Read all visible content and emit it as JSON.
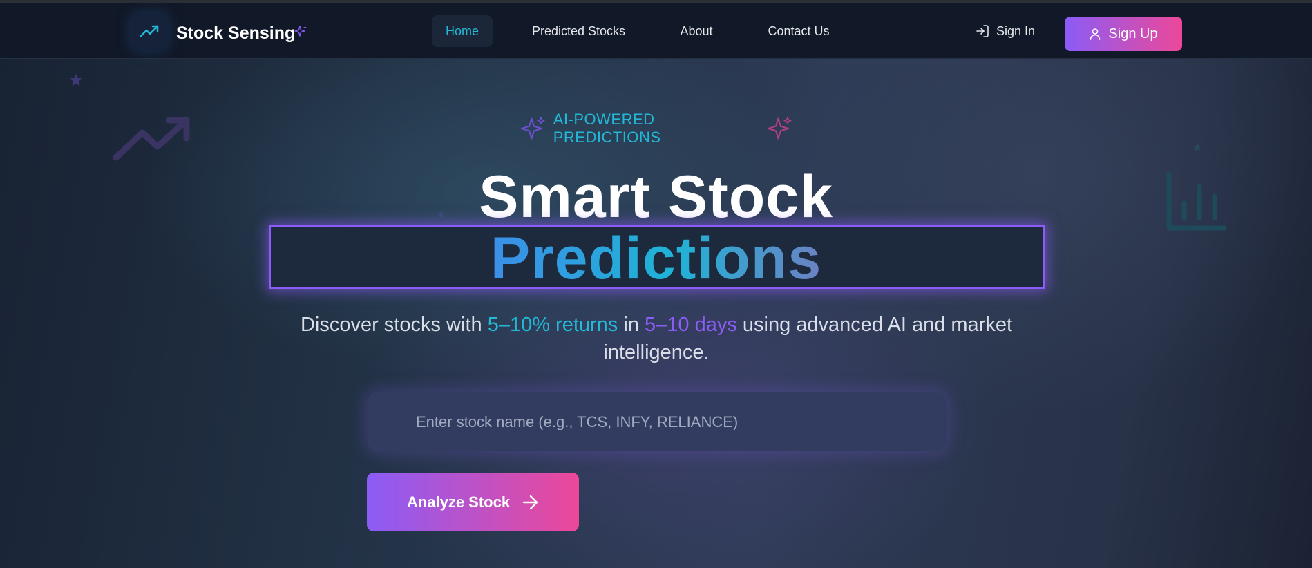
{
  "header": {
    "brand": "Stock Sensing",
    "logo_icon": "trending-up-icon",
    "nav": [
      {
        "label": "Home",
        "active": true
      },
      {
        "label": "Predicted Stocks",
        "active": false
      },
      {
        "label": "About",
        "active": false
      },
      {
        "label": "Contact Us",
        "active": false
      }
    ],
    "sign_in_label": "Sign In",
    "sign_up_label": "Sign Up"
  },
  "hero": {
    "badge": "AI-POWERED PREDICTIONS",
    "title_line1": "Smart Stock",
    "title_line2": "Predictions",
    "subtitle_pre": "Discover stocks with ",
    "subtitle_returns": "5–10% returns",
    "subtitle_mid": " in ",
    "subtitle_days": "5–10 days",
    "subtitle_post": " using advanced AI and market intelligence."
  },
  "search": {
    "value": "",
    "placeholder": "Enter stock name (e.g., TCS, INFY, RELIANCE)"
  },
  "analyze_button": {
    "label": "Analyze Stock",
    "icon": "arrow-right-icon"
  },
  "colors": {
    "accent_cyan": "#22b8d6",
    "accent_purple": "#8b5cf6",
    "accent_pink": "#ec4899",
    "header_bg": "#111827"
  }
}
